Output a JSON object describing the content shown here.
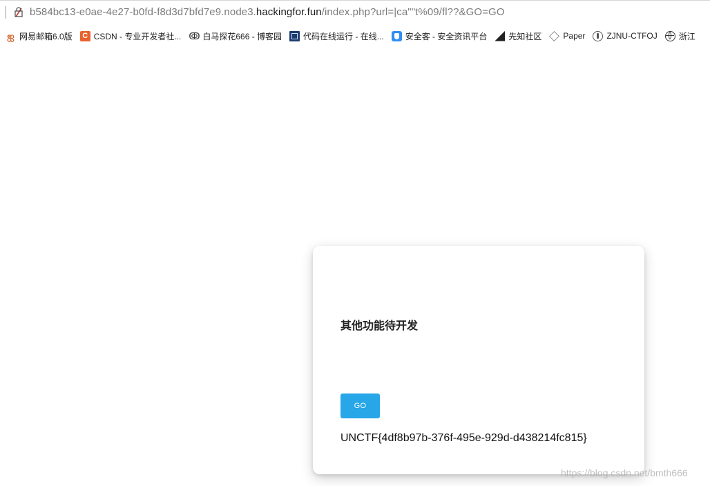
{
  "address_bar": {
    "url_prefix": "b584bc13-e0ae-4e27-b0fd-f8d3d7bfd7e9.node3.",
    "url_host": "hackingfor.fun",
    "url_path": "/index.php?url=|ca\"\"t%09/fl??&GO=GO",
    "security_icon": "not-secure-icon"
  },
  "bookmarks": [
    {
      "icon": "netease-mail-icon",
      "label": "网易邮箱6.0版"
    },
    {
      "icon": "csdn-icon",
      "label": "CSDN - 专业开发者社..."
    },
    {
      "icon": "cnblogs-icon",
      "label": "白马探花666 - 博客园"
    },
    {
      "icon": "code-runner-icon",
      "label": "代码在线运行 - 在线..."
    },
    {
      "icon": "anquanke-icon",
      "label": "安全客 - 安全资讯平台"
    },
    {
      "icon": "xianzhi-icon",
      "label": "先知社区"
    },
    {
      "icon": "paper-icon",
      "label": "Paper"
    },
    {
      "icon": "zjnu-icon",
      "label": "ZJNU-CTFOJ"
    },
    {
      "icon": "globe-icon",
      "label": "浙江"
    }
  ],
  "card": {
    "title": "其他功能待开发",
    "button_label": "GO",
    "flag_text": "UNCTF{4df8b97b-376f-495e-929d-d438214fc815}"
  },
  "watermark": "https://blog.csdn.net/bmth666",
  "colors": {
    "button": "#27a6e8",
    "background": "#ffffff"
  }
}
